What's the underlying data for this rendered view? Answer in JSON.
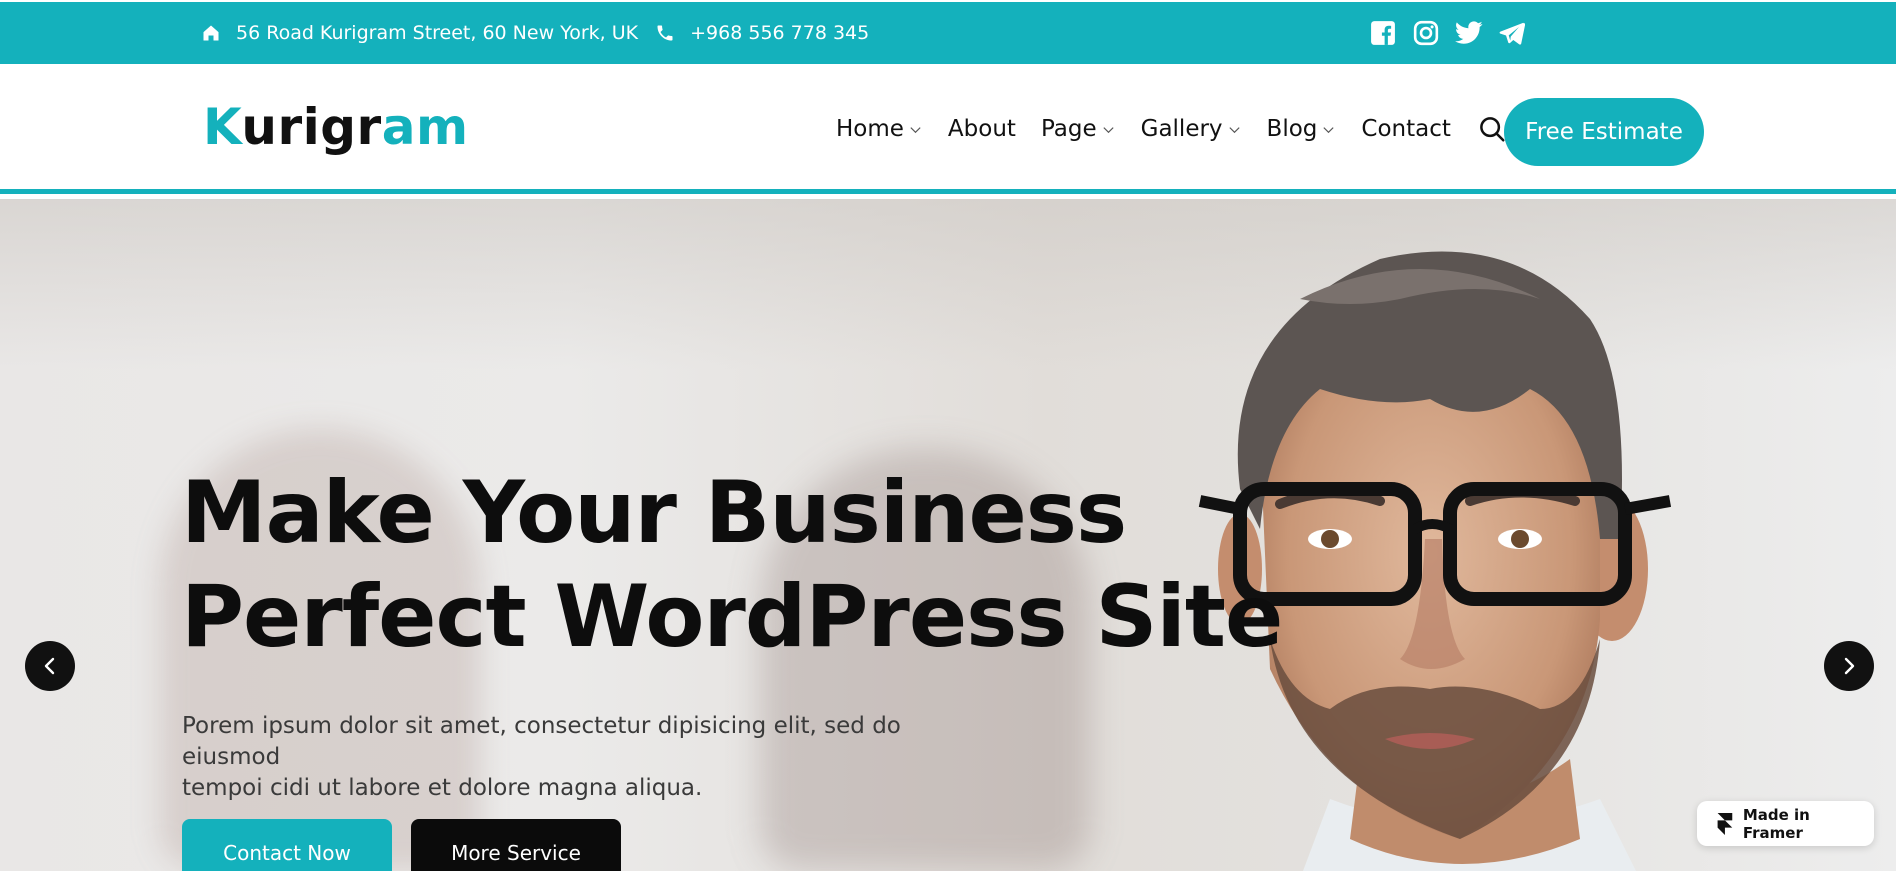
{
  "topbar": {
    "address": "56 Road Kurigram Street, 60 New York, UK",
    "phone": "+968 556 778 345",
    "social": [
      "facebook-icon",
      "instagram-icon",
      "twitter-icon",
      "telegram-icon"
    ],
    "bg_color": "#14b1bc"
  },
  "header": {
    "logo_part1": "K",
    "logo_part2": "urigr",
    "logo_part3": "am",
    "nav": [
      {
        "label": "Home",
        "dropdown": true
      },
      {
        "label": "About",
        "dropdown": false
      },
      {
        "label": "Page",
        "dropdown": true
      },
      {
        "label": "Gallery",
        "dropdown": true
      },
      {
        "label": "Blog",
        "dropdown": true
      },
      {
        "label": "Contact",
        "dropdown": false
      }
    ],
    "cta_label": "Free Estimate",
    "accent_color": "#14b1bc"
  },
  "hero": {
    "headline_line1": "Make Your Business",
    "headline_line2": "Perfect WordPress Site",
    "subtext_line1": "Porem ipsum dolor sit amet, consectetur dipisicing elit, sed do eiusmod",
    "subtext_line2": "tempoi cidi ut labore et dolore magna aliqua.",
    "primary_button": "Contact Now",
    "secondary_button": "More Service"
  },
  "badge": {
    "label": "Made in Framer"
  }
}
